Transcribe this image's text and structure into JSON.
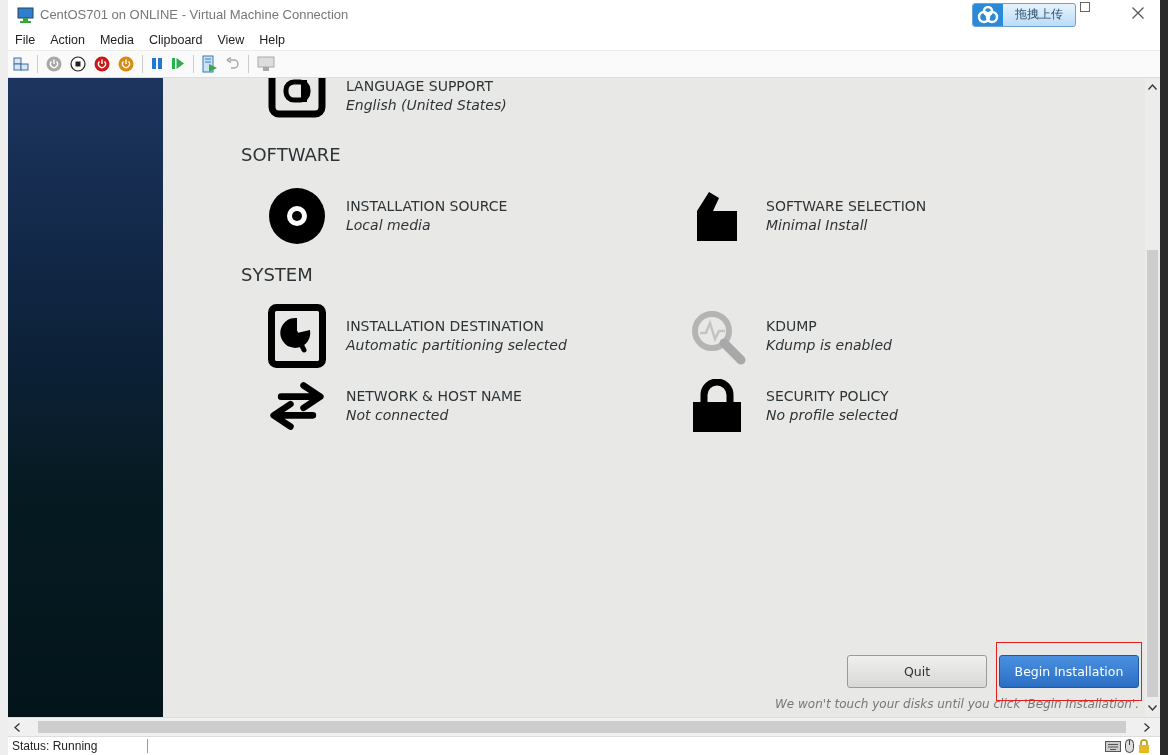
{
  "window": {
    "title": "CentOS701 on ONLINE - Virtual Machine Connection",
    "upload_button": "拖拽上传"
  },
  "menu": [
    "File",
    "Action",
    "Media",
    "Clipboard",
    "View",
    "Help"
  ],
  "toolbar": [
    [
      {
        "kind": "ctrl-alt-del",
        "disabled": false
      }
    ],
    [
      {
        "kind": "start",
        "disabled": true
      },
      {
        "kind": "turn-off",
        "disabled": false
      },
      {
        "kind": "shut-down",
        "disabled": false
      },
      {
        "kind": "save",
        "disabled": false
      }
    ],
    [
      {
        "kind": "pause",
        "disabled": false
      },
      {
        "kind": "reset",
        "disabled": false
      }
    ],
    [
      {
        "kind": "checkpoint",
        "disabled": false
      },
      {
        "kind": "revert",
        "disabled": true
      }
    ],
    [
      {
        "kind": "enhanced-session",
        "disabled": true
      }
    ]
  ],
  "top_items": [
    {
      "kind": "language",
      "title": "LANGUAGE SUPPORT",
      "status": "English (United States)"
    }
  ],
  "sections": [
    {
      "heading": "SOFTWARE",
      "items": [
        {
          "kind": "disc",
          "title": "INSTALLATION SOURCE",
          "status": "Local media"
        },
        {
          "kind": "package",
          "title": "SOFTWARE SELECTION",
          "status": "Minimal Install"
        }
      ]
    },
    {
      "heading": "SYSTEM",
      "items": [
        {
          "kind": "disk",
          "title": "INSTALLATION DESTINATION",
          "status": "Automatic partitioning selected"
        },
        {
          "kind": "search",
          "title": "KDUMP",
          "status": "Kdump is enabled"
        },
        {
          "kind": "network",
          "title": "NETWORK & HOST NAME",
          "status": "Not connected"
        },
        {
          "kind": "lock",
          "title": "SECURITY POLICY",
          "status": "No profile selected"
        }
      ]
    }
  ],
  "buttons": [
    {
      "label": "Quit",
      "kind": "secondary",
      "highlighted": false
    },
    {
      "label": "Begin Installation",
      "kind": "primary",
      "highlighted": true
    }
  ],
  "note": "We won't touch your disks until you click 'Begin Installation'.",
  "status_bar": {
    "status": "Status: Running"
  }
}
